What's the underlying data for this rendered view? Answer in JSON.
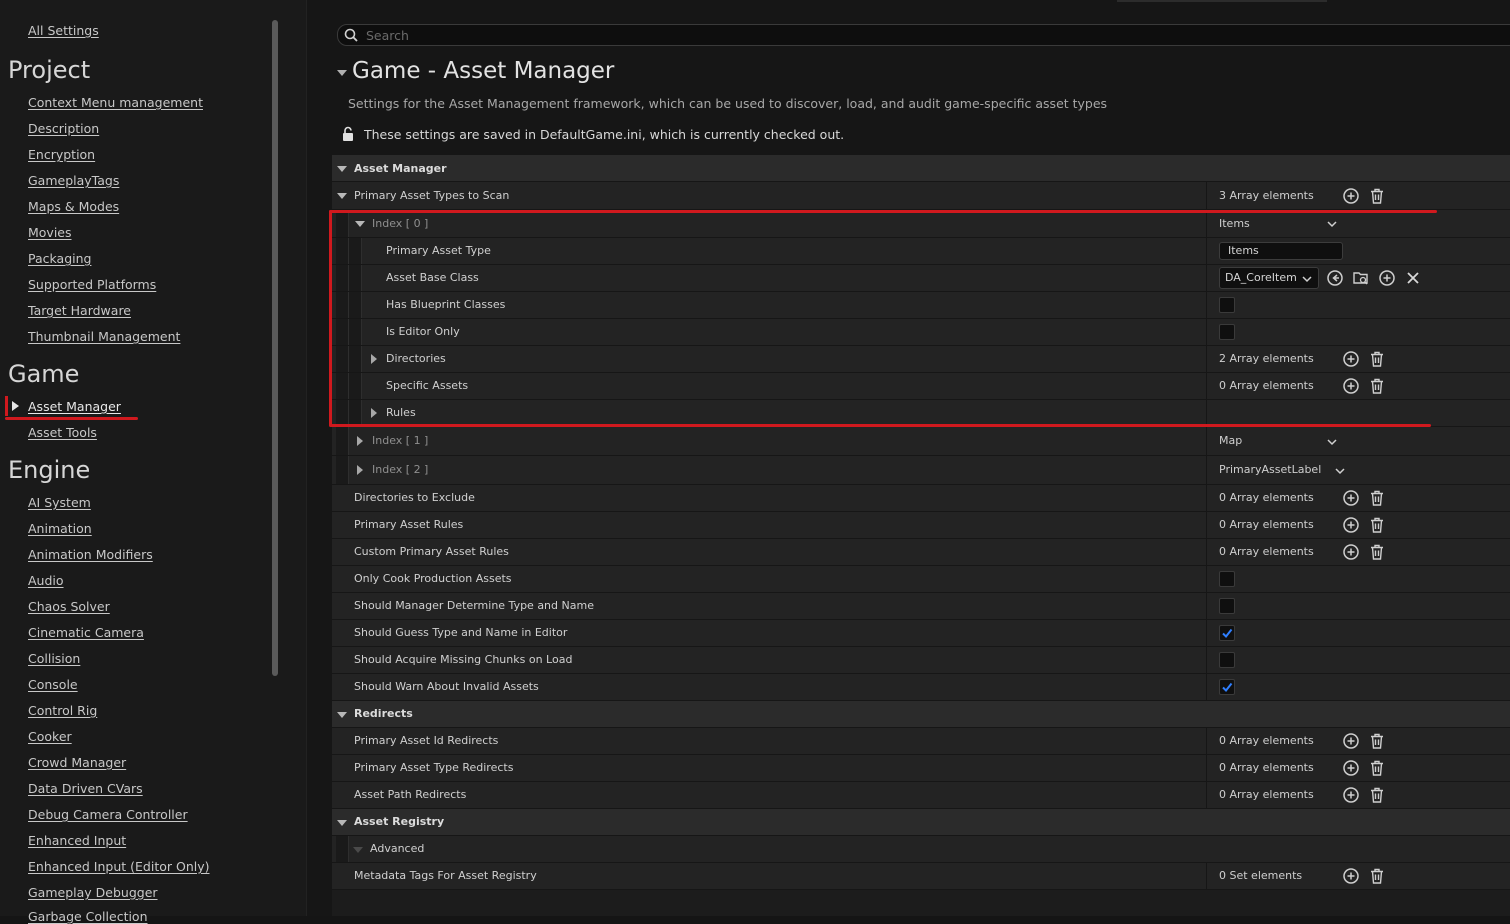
{
  "sidebar": {
    "all_settings": "All Settings",
    "sections": [
      {
        "title": "Project",
        "items": [
          "Context Menu management",
          "Description",
          "Encryption",
          "GameplayTags",
          "Maps & Modes",
          "Movies",
          "Packaging",
          "Supported Platforms",
          "Target Hardware",
          "Thumbnail Management"
        ]
      },
      {
        "title": "Game",
        "items": [
          "Asset Manager",
          "Asset Tools"
        ]
      },
      {
        "title": "Engine",
        "items": [
          "AI System",
          "Animation",
          "Animation Modifiers",
          "Audio",
          "Chaos Solver",
          "Cinematic Camera",
          "Collision",
          "Console",
          "Control Rig",
          "Cooker",
          "Crowd Manager",
          "Data Driven CVars",
          "Debug Camera Controller",
          "Enhanced Input",
          "Enhanced Input (Editor Only)",
          "Gameplay Debugger",
          "Garbage Collection"
        ]
      }
    ],
    "selected": "Asset Manager"
  },
  "search": {
    "placeholder": "Search"
  },
  "header": {
    "title": "Game - Asset Manager",
    "description": "Settings for the Asset Management framework, which can be used to discover, load, and audit game-specific asset types",
    "save_note": "These settings are saved in DefaultGame.ini, which is currently checked out."
  },
  "grid": {
    "cat_asset_manager": "Asset Manager",
    "primary_asset_types_to_scan": {
      "label": "Primary Asset Types to Scan",
      "value": "3 Array elements"
    },
    "index0": {
      "label": "Index [ 0 ]",
      "value": "Items"
    },
    "primary_asset_type": {
      "label": "Primary Asset Type",
      "value": "Items"
    },
    "asset_base_class": {
      "label": "Asset Base Class",
      "value": "DA_CoreItem"
    },
    "has_blueprint_classes": {
      "label": "Has Blueprint Classes",
      "checked": false
    },
    "is_editor_only": {
      "label": "Is Editor Only",
      "checked": false
    },
    "directories": {
      "label": "Directories",
      "value": "2 Array elements"
    },
    "specific_assets": {
      "label": "Specific Assets",
      "value": "0 Array elements"
    },
    "rules": {
      "label": "Rules"
    },
    "index1": {
      "label": "Index [ 1 ]",
      "value": "Map"
    },
    "index2": {
      "label": "Index [ 2 ]",
      "value": "PrimaryAssetLabel"
    },
    "directories_to_exclude": {
      "label": "Directories to Exclude",
      "value": "0 Array elements"
    },
    "primary_asset_rules": {
      "label": "Primary Asset Rules",
      "value": "0 Array elements"
    },
    "custom_primary_asset_rules": {
      "label": "Custom Primary Asset Rules",
      "value": "0 Array elements"
    },
    "only_cook_production_assets": {
      "label": "Only Cook Production Assets",
      "checked": false
    },
    "should_manager_determine": {
      "label": "Should Manager Determine Type and Name",
      "checked": false
    },
    "should_guess_type": {
      "label": "Should Guess Type and Name in Editor",
      "checked": true
    },
    "should_acquire_missing": {
      "label": "Should Acquire Missing Chunks on Load",
      "checked": false
    },
    "should_warn_invalid": {
      "label": "Should Warn About Invalid Assets",
      "checked": true
    },
    "cat_redirects": "Redirects",
    "primary_asset_id_redirects": {
      "label": "Primary Asset Id Redirects",
      "value": "0 Array elements"
    },
    "primary_asset_type_redirects": {
      "label": "Primary Asset Type Redirects",
      "value": "0 Array elements"
    },
    "asset_path_redirects": {
      "label": "Asset Path Redirects",
      "value": "0 Array elements"
    },
    "cat_asset_registry": "Asset Registry",
    "advanced": "Advanced",
    "metadata_tags": {
      "label": "Metadata Tags For Asset Registry",
      "value": "0 Set elements"
    }
  },
  "colors": {
    "annotation_red": "#d0191e",
    "check_blue": "#2f7fff",
    "background": "#151515"
  }
}
